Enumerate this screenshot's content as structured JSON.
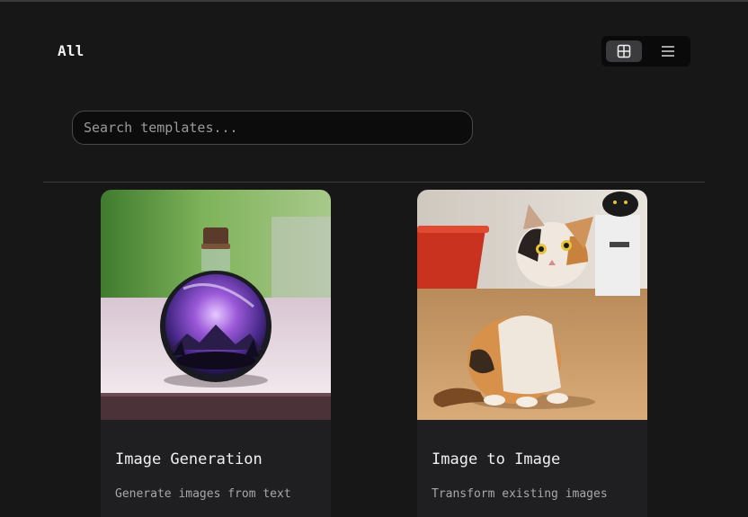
{
  "header": {
    "category_title": "All"
  },
  "view_toggle": {
    "active": "grid",
    "options": [
      "grid",
      "list"
    ]
  },
  "search": {
    "placeholder": "Search templates...",
    "value": ""
  },
  "templates": [
    {
      "title": "Image Generation",
      "description": "Generate images from text",
      "thumbnail": "glass-bottle-galaxy"
    },
    {
      "title": "Image to Image",
      "description": "Transform existing images",
      "thumbnail": "calico-kitten"
    }
  ],
  "colors": {
    "background": "#171718",
    "card": "#1f1f21",
    "toggle_active": "#3b3b3d"
  }
}
